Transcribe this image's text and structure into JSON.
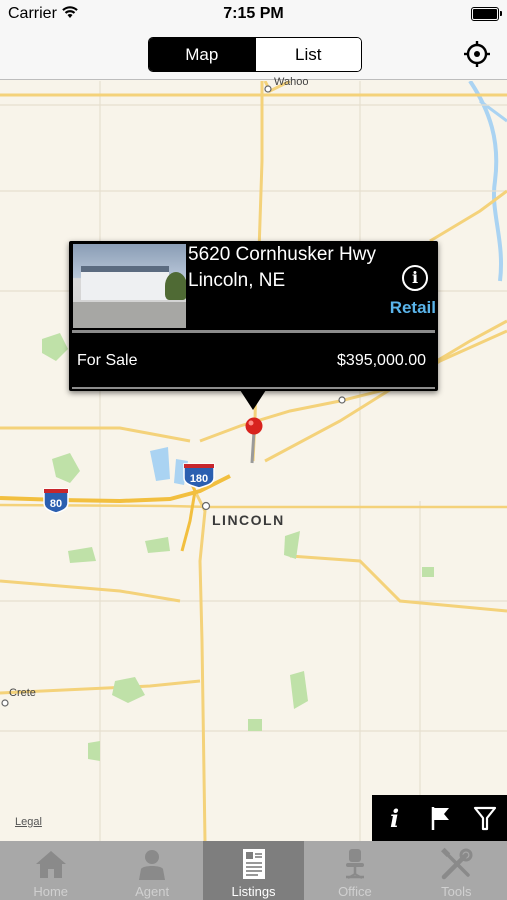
{
  "status_bar": {
    "carrier": "Carrier",
    "time": "7:15 PM"
  },
  "nav": {
    "segments": [
      {
        "label": "Map",
        "active": true
      },
      {
        "label": "List",
        "active": false
      }
    ],
    "locate_icon": "crosshair-icon"
  },
  "map": {
    "city_label": "LINCOLN",
    "town_labels": {
      "top": "Wahoo",
      "left": "Crete"
    },
    "highway_shields": [
      "80",
      "180"
    ],
    "legal": "Legal"
  },
  "callout": {
    "address_line1": "5620 Cornhusker Hwy",
    "address_line2": "Lincoln, NE",
    "property_type": "Retail",
    "status": "For Sale",
    "price": "$395,000.00",
    "info_icon": "info-icon",
    "accent_color": "#5ab4ea"
  },
  "map_tools": {
    "info_label": "i",
    "icons": [
      "info-icon",
      "flag-icon",
      "filter-icon"
    ]
  },
  "tab_bar": {
    "tabs": [
      {
        "label": "Home",
        "icon": "house-icon",
        "active": false
      },
      {
        "label": "Agent",
        "icon": "person-icon",
        "active": false
      },
      {
        "label": "Listings",
        "icon": "document-icon",
        "active": true
      },
      {
        "label": "Office",
        "icon": "office-chair-icon",
        "active": false
      },
      {
        "label": "Tools",
        "icon": "tools-icon",
        "active": false
      }
    ]
  }
}
